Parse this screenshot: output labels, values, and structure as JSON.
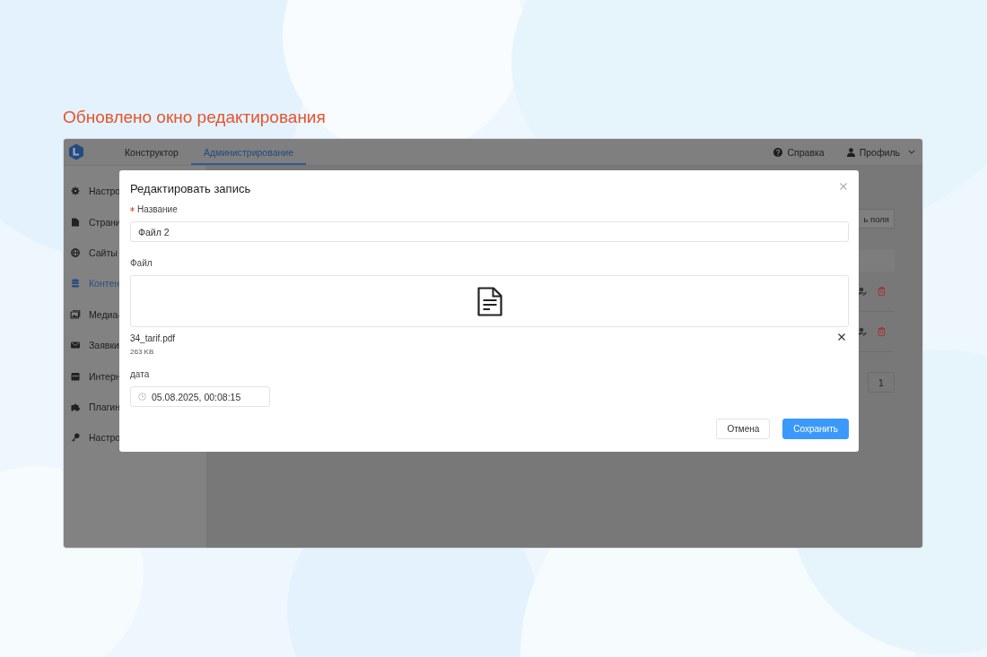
{
  "slide": {
    "title": "Обновлено окно редактирования"
  },
  "header": {
    "tabs": [
      {
        "label": "Конструктор",
        "selected": false
      },
      {
        "label": "Администрирование",
        "selected": true
      }
    ],
    "help": "Справка",
    "profile": "Профиль"
  },
  "sidebar": {
    "items": [
      {
        "label": "Настро",
        "selected": false
      },
      {
        "label": "Страни",
        "selected": false
      },
      {
        "label": "Сайты",
        "selected": false
      },
      {
        "label": "Контен",
        "selected": true
      },
      {
        "label": "Медиа-",
        "selected": false
      },
      {
        "label": "Заявки",
        "selected": false
      },
      {
        "label": "Интерн",
        "selected": false
      },
      {
        "label": "Плагин",
        "selected": false
      },
      {
        "label": "Настро",
        "selected": false
      }
    ]
  },
  "content": {
    "button": "ь поля",
    "page": "1"
  },
  "modal": {
    "title": "Редактировать запись",
    "fields": [
      {
        "kind": "text",
        "label": "Название",
        "required": true,
        "value": "Файл 2"
      },
      {
        "kind": "file",
        "label": "Файл",
        "required": false,
        "file_name": "34_tarif.pdf",
        "file_size": "263 KB"
      },
      {
        "kind": "datetime",
        "label": "дата",
        "required": false,
        "value": "05.08.2025, 00:08:15"
      }
    ],
    "buttons": [
      {
        "label": "Отмена",
        "kind": "default"
      },
      {
        "label": "Сохранить",
        "kind": "primary"
      }
    ]
  }
}
